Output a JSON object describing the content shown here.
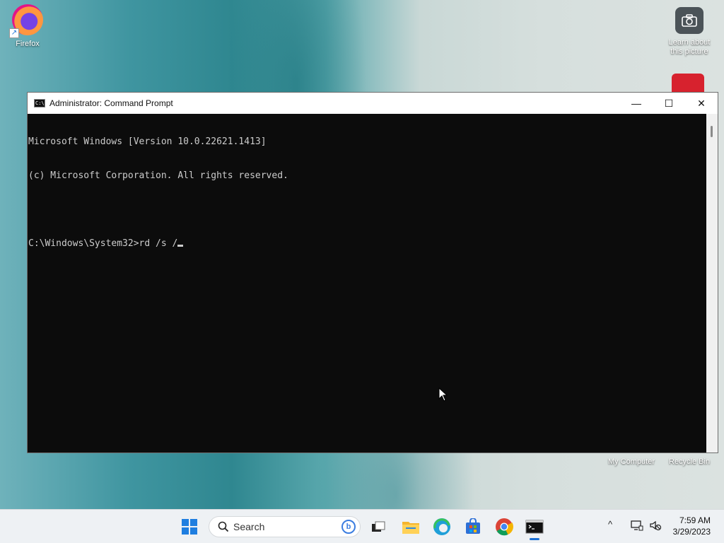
{
  "desktop": {
    "icons": [
      {
        "label": "Firefox"
      },
      {
        "label": "Learn about this picture"
      },
      {
        "label": "My Computer"
      },
      {
        "label": "Recycle Bin"
      }
    ]
  },
  "window": {
    "title": "Administrator: Command Prompt",
    "controls": {
      "minimize": "—",
      "maximize": "☐",
      "close": "✕"
    },
    "console_lines": [
      "Microsoft Windows [Version 10.0.22621.1413]",
      "(c) Microsoft Corporation. All rights reserved.",
      "",
      "C:\\Windows\\System32>rd /s /"
    ]
  },
  "taskbar": {
    "search_placeholder": "Search",
    "pinned": [
      "start-icon",
      "task-view-icon",
      "file-explorer-icon",
      "edge-icon",
      "store-icon",
      "chrome-icon",
      "command-prompt-icon"
    ],
    "tray": {
      "overflow": "^",
      "time": "7:59 AM",
      "date": "3/29/2023"
    }
  },
  "colors": {
    "accent": "#1a6fd4",
    "console_bg": "#0c0c0c",
    "console_text": "#cccccc"
  }
}
